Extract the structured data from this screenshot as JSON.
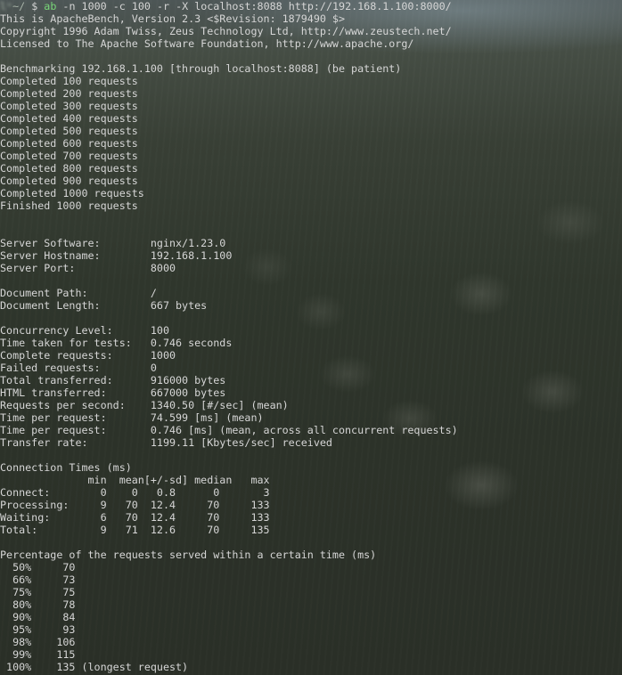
{
  "prompt": {
    "user": "lᵒ",
    "path": "~/",
    "symbol": "$"
  },
  "command": {
    "name": "ab",
    "args": "-n 1000 -c 100 -r -X localhost:8088 http://192.168.1.100:8000/"
  },
  "output_lines": [
    "This is ApacheBench, Version 2.3 <$Revision: 1879490 $>",
    "Copyright 1996 Adam Twiss, Zeus Technology Ltd, http://www.zeustech.net/",
    "Licensed to The Apache Software Foundation, http://www.apache.org/",
    "",
    "Benchmarking 192.168.1.100 [through localhost:8088] (be patient)",
    "Completed 100 requests",
    "Completed 200 requests",
    "Completed 300 requests",
    "Completed 400 requests",
    "Completed 500 requests",
    "Completed 600 requests",
    "Completed 700 requests",
    "Completed 800 requests",
    "Completed 900 requests",
    "Completed 1000 requests",
    "Finished 1000 requests",
    "",
    "",
    "Server Software:        nginx/1.23.0",
    "Server Hostname:        192.168.1.100",
    "Server Port:            8000",
    "",
    "Document Path:          /",
    "Document Length:        667 bytes",
    "",
    "Concurrency Level:      100",
    "Time taken for tests:   0.746 seconds",
    "Complete requests:      1000",
    "Failed requests:        0",
    "Total transferred:      916000 bytes",
    "HTML transferred:       667000 bytes",
    "Requests per second:    1340.50 [#/sec] (mean)",
    "Time per request:       74.599 [ms] (mean)",
    "Time per request:       0.746 [ms] (mean, across all concurrent requests)",
    "Transfer rate:          1199.11 [Kbytes/sec] received",
    "",
    "Connection Times (ms)",
    "              min  mean[+/-sd] median   max",
    "Connect:        0    0   0.8      0       3",
    "Processing:     9   70  12.4     70     133",
    "Waiting:        6   70  12.4     70     133",
    "Total:          9   71  12.6     70     135",
    "",
    "Percentage of the requests served within a certain time (ms)",
    "  50%     70",
    "  66%     73",
    "  75%     75",
    "  80%     78",
    "  90%     84",
    "  95%     93",
    "  98%    106",
    "  99%    115",
    " 100%    135 (longest request)"
  ]
}
